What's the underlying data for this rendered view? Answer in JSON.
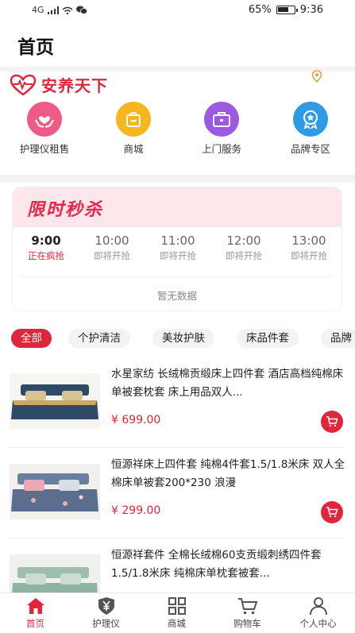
{
  "status_bar": {
    "network": "4G",
    "battery": "65%",
    "time": "9:36"
  },
  "header": {
    "title": "首页"
  },
  "brand": {
    "name": "安养天下",
    "logo_icon": "heart-pulse-icon",
    "location_icon": "location-pin-icon"
  },
  "quick_entries": [
    {
      "label": "护理仪租售",
      "icon": "hands-heart-icon",
      "color": "#ef5b86"
    },
    {
      "label": "商城",
      "icon": "shopping-bag-icon",
      "color": "#f6b61d"
    },
    {
      "label": "上门服务",
      "icon": "toolbox-icon",
      "color": "#9b5ae0"
    },
    {
      "label": "品牌专区",
      "icon": "award-badge-icon",
      "color": "#2f9be5"
    }
  ],
  "flash_sale": {
    "title": "限时秒杀",
    "slots": [
      {
        "time": "9:00",
        "status": "正在疯抢",
        "active": true
      },
      {
        "time": "10:00",
        "status": "即将开抢",
        "active": false
      },
      {
        "time": "11:00",
        "status": "即将开抢",
        "active": false
      },
      {
        "time": "12:00",
        "status": "即将开抢",
        "active": false
      },
      {
        "time": "13:00",
        "status": "即将开抢",
        "active": false
      }
    ],
    "empty_text": "暂无数据"
  },
  "category_tabs": [
    {
      "label": "全部",
      "active": true
    },
    {
      "label": "个护清洁",
      "active": false
    },
    {
      "label": "美妆护肤",
      "active": false
    },
    {
      "label": "床品件套",
      "active": false
    },
    {
      "label": "品牌",
      "active": false
    }
  ],
  "products": [
    {
      "title": "水星家纺 长绒棉贡缎床上四件套 酒店高档纯棉床单被套枕套 床上用品双人...",
      "price": "¥ 699.00",
      "color": "#2f4a66"
    },
    {
      "title": "恒源祥床上四件套 纯棉4件套1.5/1.8米床 双人全棉床单被套200*230 浪漫",
      "price": "¥ 299.00",
      "color": "#5b6e8e"
    },
    {
      "title": "恒源祥套件 全棉长绒棉60支贡缎刺绣四件套1.5/1.8米床 纯棉床单枕套被套...",
      "price": "",
      "color": "#8fb3a2"
    }
  ],
  "bottom_nav": [
    {
      "label": "首页",
      "icon": "home-icon",
      "active": true
    },
    {
      "label": "护理仪",
      "icon": "yuan-shield-icon",
      "active": false
    },
    {
      "label": "商城",
      "icon": "grid-apps-icon",
      "active": false
    },
    {
      "label": "购物车",
      "icon": "cart-icon",
      "active": false
    },
    {
      "label": "个人中心",
      "icon": "person-icon",
      "active": false
    }
  ]
}
